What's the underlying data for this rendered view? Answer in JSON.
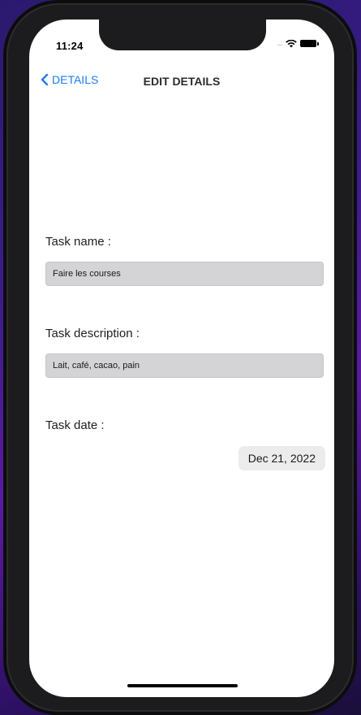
{
  "status_bar": {
    "time": "11:24",
    "signal_dots": "....",
    "wifi": "wifi-icon",
    "battery": "battery-icon"
  },
  "navbar": {
    "back_label": "DETAILS",
    "title": "EDIT DETAILS",
    "back_icon": "chevron-left-icon"
  },
  "form": {
    "task_name_label": "Task name :",
    "task_name_value": "Faire les courses",
    "task_description_label": "Task description :",
    "task_description_value": "Lait, café, cacao, pain",
    "task_date_label": "Task date :",
    "task_date_value": "Dec 21, 2022"
  },
  "colors": {
    "accent": "#1a7cf5",
    "field_bg": "#d4d4d6",
    "date_pill_bg": "#ececed"
  }
}
